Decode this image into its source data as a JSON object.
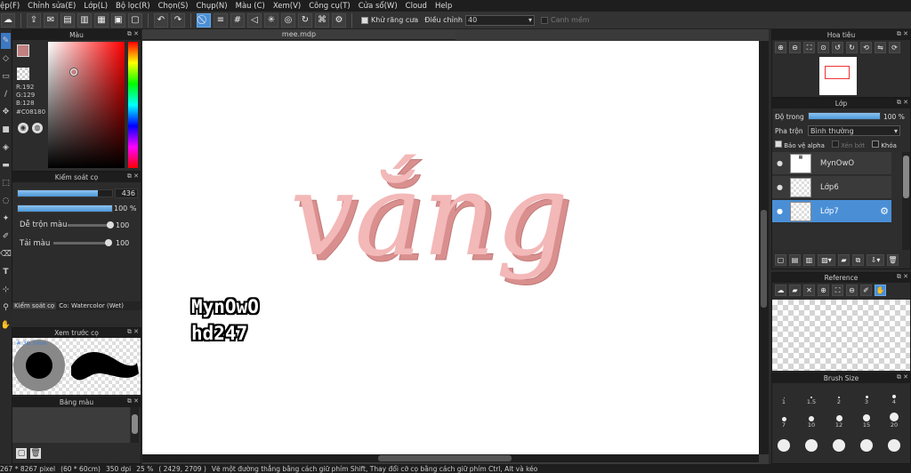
{
  "menu": [
    "ệp(F)",
    "Chỉnh sửa(E)",
    "Lớp(L)",
    "Bộ lọc(R)",
    "Chọn(S)",
    "Chụp(N)",
    "Màu (C)",
    "Xem(V)",
    "Công cụ(T)",
    "Cửa sổ(W)",
    "Cloud",
    "Help"
  ],
  "toolbar": {
    "antialias_label": "Khử răng cưa",
    "adjust_label": "Điều chỉnh",
    "adjust_value": "40",
    "smooth_label": "Canh mềm"
  },
  "color_panel": {
    "title": "Màu",
    "r": "R:192",
    "g": "G:129",
    "b": "B:128",
    "hex": "#C08180",
    "current": "#c08180"
  },
  "brush_control": {
    "title": "Kiểm soát cọ",
    "size_value": "436",
    "opacity_value": "100 %",
    "mix_label": "Dễ trộn màu",
    "mix_value": "100",
    "reload_label": "Tải màu",
    "reload_value": "100",
    "size_fill": 0.85,
    "opacity_fill": 1.0,
    "mix_fill": 0.95,
    "reload_fill": 0.95
  },
  "brush_tab": {
    "tab_label": "Kiểm soát cọ",
    "brush_name": "Co: Watercolor (Wet)"
  },
  "preview": {
    "title": "Xem trước cọ",
    "size_text": "# 36.7mm"
  },
  "palette": {
    "title": "Bảng màu"
  },
  "document": {
    "tab": "mee.mdp",
    "artwork_text": "vắng",
    "watermark_line1": "MynOwO",
    "watermark_line2": "hd247"
  },
  "navigator": {
    "title": "Hoa tiêu"
  },
  "layers": {
    "title": "Lớp",
    "opacity_label": "Độ trong",
    "opacity_value": "100 %",
    "opacity_fill": 1.0,
    "blend_label": "Pha trộn",
    "blend_value": "Bình thường",
    "protect_alpha": "Bảo vệ alpha",
    "clip_label": "Xén bớt",
    "lock_label": "Khóa",
    "items": [
      {
        "name": "MynOwO"
      },
      {
        "name": "Lớp6"
      },
      {
        "name": "Lớp7"
      }
    ]
  },
  "reference": {
    "title": "Reference"
  },
  "brush_size": {
    "title": "Brush Size",
    "sizes": [
      "1",
      "1.5",
      "2",
      "3",
      "4",
      "7",
      "10",
      "12",
      "15",
      "20"
    ]
  },
  "status": {
    "size": "267 * 8267 pixel",
    "cm": "(60 * 60cm)",
    "dpi": "350 dpi",
    "zoom": "25 %",
    "coords": "( 2429, 2709 )",
    "hint": "Vẽ một đường thẳng bằng cách giữ phím Shift, Thay đổi cỡ cọ bằng cách giữ phím Ctrl, Alt và kéo"
  }
}
